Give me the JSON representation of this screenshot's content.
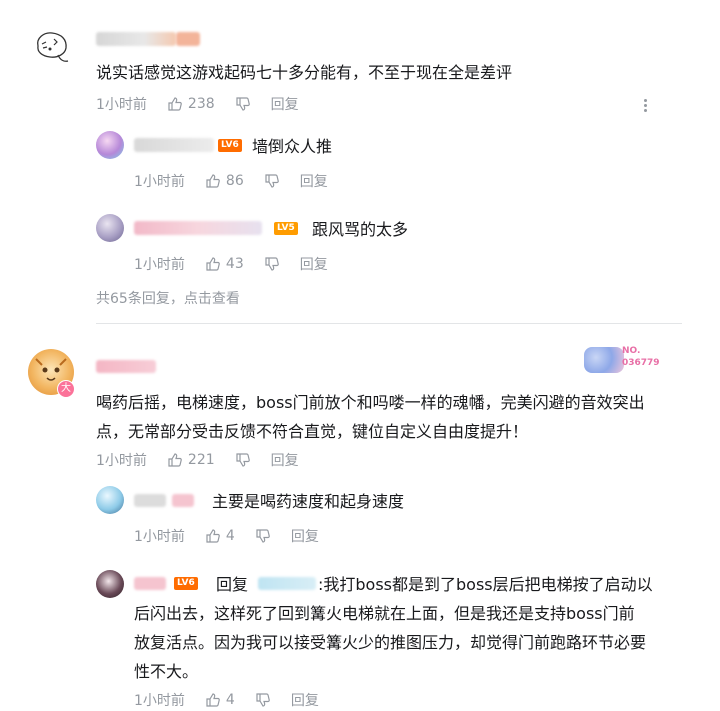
{
  "comments": [
    {
      "text": "说实话感觉这游戏起码七十多分能有，不至于现在全是差评",
      "time": "1小时前",
      "likes": "238",
      "reply_label": "回复",
      "replies": [
        {
          "level": "LV6",
          "text": "墙倒众人推",
          "time": "1小时前",
          "likes": "86",
          "reply_label": "回复"
        },
        {
          "level": "LV5",
          "text": "跟风骂的太多",
          "time": "1小时前",
          "likes": "43",
          "reply_label": "回复"
        }
      ],
      "more_replies": "共65条回复，点击查看"
    },
    {
      "badge": "大",
      "fan_number": "NO.\n036779",
      "text_lines": [
        "喝药后摇，电梯速度，boss门前放个和吗喽一样的魂幡，完美闪避的音效突出",
        "点，无常部分受击反馈不符合直觉，键位自定义自由度提升！"
      ],
      "time": "1小时前",
      "likes": "221",
      "reply_label": "回复",
      "replies": [
        {
          "text": "主要是喝药速度和起身速度",
          "time": "1小时前",
          "likes": "4",
          "reply_label": "回复"
        },
        {
          "level": "LV6",
          "reply_prefix": "回复",
          "text_lines": [
            ":我打boss都是到了boss层后把电梯按了启动以",
            "后闪出去，这样死了回到篝火电梯就在上面，但是我还是支持boss门前",
            "放复活点。因为我可以接受篝火少的推图压力，却觉得门前跑路环节必要",
            "性不大。"
          ],
          "time": "1小时前",
          "likes": "4",
          "reply_label": "回复"
        }
      ]
    }
  ],
  "colors": {
    "text": "#18191c",
    "meta": "#9499a0",
    "divider": "#e3e5e7",
    "lv6": "#ff6c00",
    "lv5": "#ff9c00",
    "mention": "#0c8ccc"
  },
  "icons": {
    "like": "thumb-up-icon",
    "dislike": "thumb-down-icon",
    "more": "more-vertical-icon"
  }
}
